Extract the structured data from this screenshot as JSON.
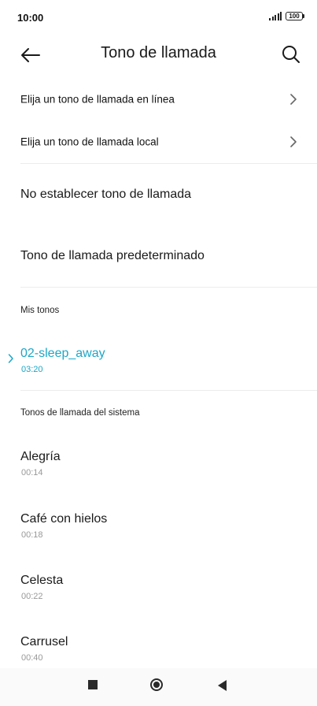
{
  "status_bar": {
    "time": "10:00",
    "battery": "100"
  },
  "toolbar": {
    "title": "Tono de llamada"
  },
  "nav_rows": [
    {
      "label": "Elija un tono de llamada en línea"
    },
    {
      "label": "Elija un tono de llamada local"
    }
  ],
  "options": [
    {
      "label": "No establecer tono de llamada"
    },
    {
      "label": "Tono de llamada predeterminado"
    }
  ],
  "my_tones": {
    "header": "Mis tonos",
    "items": [
      {
        "name": "02-sleep_away",
        "duration": "03:20",
        "selected": true
      }
    ]
  },
  "system_tones": {
    "header": "Tonos de llamada del sistema",
    "items": [
      {
        "name": "Alegría",
        "duration": "00:14"
      },
      {
        "name": "Café con hielos",
        "duration": "00:18"
      },
      {
        "name": "Celesta",
        "duration": "00:22"
      },
      {
        "name": "Carrusel",
        "duration": "00:40"
      }
    ]
  },
  "colors": {
    "accent": "#1aa7c8",
    "text": "#1a1a1a",
    "secondary": "#999999"
  },
  "icons": [
    "back-arrow-icon",
    "search-icon",
    "chevron-right-icon",
    "signal-icon",
    "battery-icon"
  ]
}
